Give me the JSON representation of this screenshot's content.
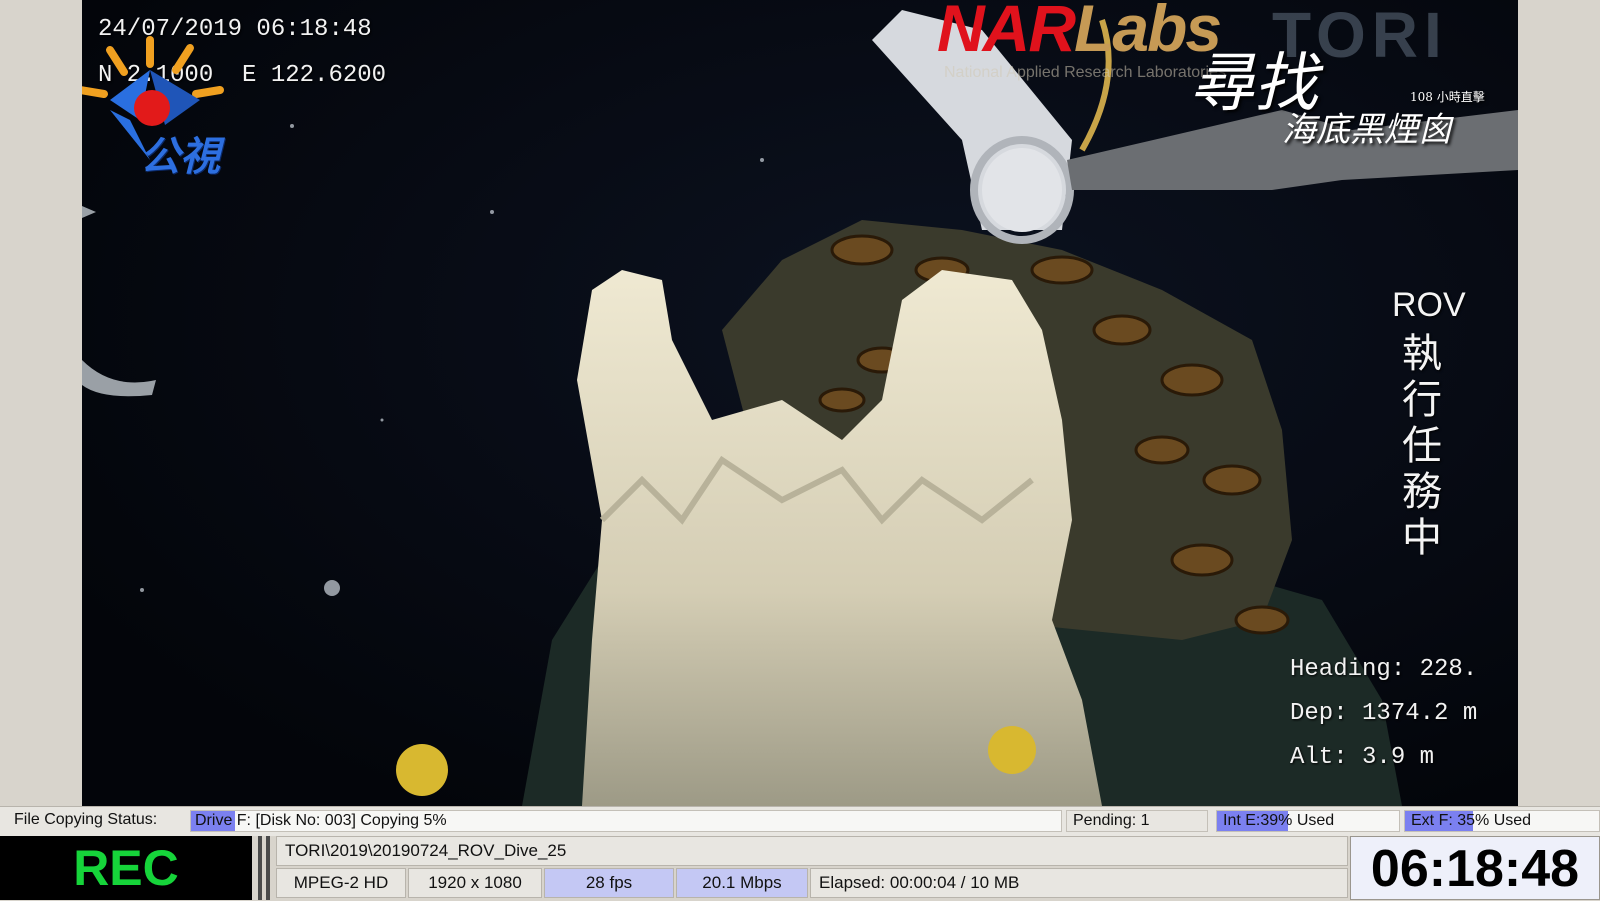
{
  "video": {
    "osd": {
      "datetime": "24/07/2019 06:18:48",
      "coordinates": "N 2.1000  E 122.6200",
      "heading": "Heading: 228.",
      "depth": "Dep: 1374.2 m",
      "altitude": "Alt: 3.9 m"
    },
    "logos": {
      "broadcaster": "公視",
      "narlabs_red": "NAR",
      "narlabs_gold": "Labs",
      "narlabs_subtitle": "National Applied Research Laboratories",
      "tori_faint": "TORI"
    },
    "program_title": {
      "line1": "尋找",
      "line2": "海底黑煙囪",
      "tag": "108 小時直擊"
    },
    "rov_task": {
      "label": "ROV",
      "status": "執行任務中"
    }
  },
  "status_bar": {
    "file_copying_label": "File Copying Status:",
    "copy_progress_text": "Drive F: [Disk No: 003] Copying 5%",
    "copy_progress_percent": 5,
    "pending": "Pending: 1",
    "int_usage_text": "Int E:39% Used",
    "int_usage_percent": 39,
    "ext_usage_text": "Ext F: 35% Used",
    "ext_usage_percent": 35
  },
  "recorder": {
    "rec_label": "REC",
    "file_path": "TORI\\2019\\20190724_ROV_Dive_25",
    "codec": "MPEG-2 HD",
    "resolution": "1920 x 1080",
    "framerate": "28 fps",
    "bitrate": "20.1 Mbps",
    "elapsed": "Elapsed: 00:00:04 / 10 MB",
    "clock": "06:18:48"
  },
  "colors": {
    "rec_green": "#16d43a",
    "progress_blue": "#7b80f0",
    "narlabs_red": "#e0121c"
  }
}
